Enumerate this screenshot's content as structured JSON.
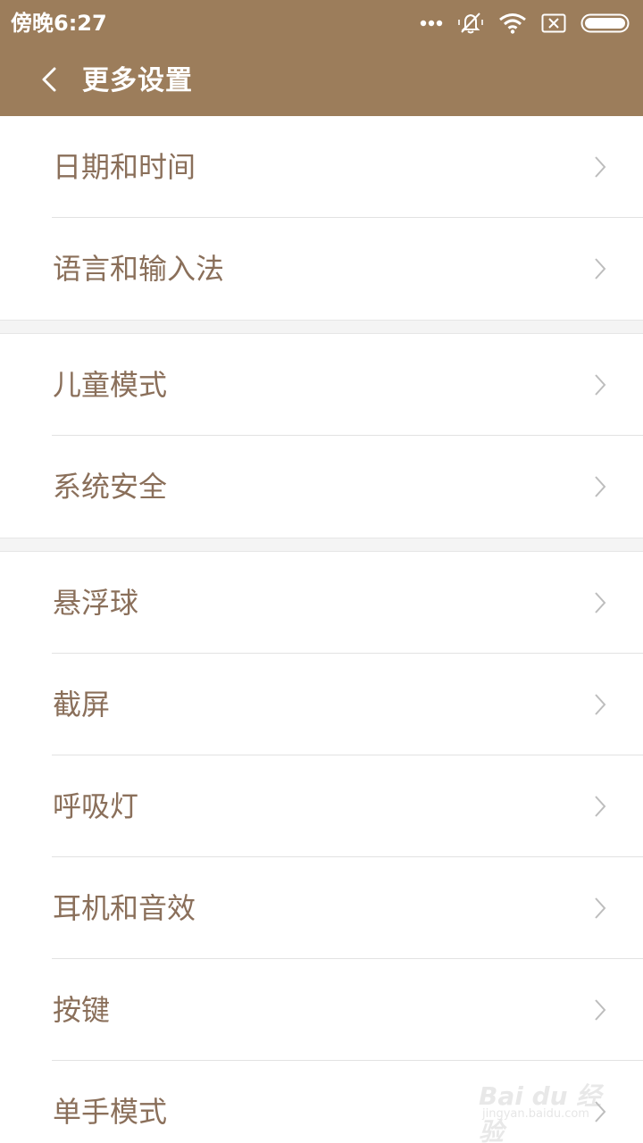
{
  "status_bar": {
    "time": "傍晚6:27",
    "icons": [
      "more-dots-icon",
      "bell-mute-icon",
      "wifi-icon",
      "no-sim-icon",
      "battery-icon"
    ]
  },
  "header": {
    "back_icon": "chevron-left-icon",
    "title": "更多设置"
  },
  "groups": [
    {
      "items": [
        {
          "label": "日期和时间"
        },
        {
          "label": "语言和输入法"
        }
      ]
    },
    {
      "items": [
        {
          "label": "儿童模式"
        },
        {
          "label": "系统安全"
        }
      ]
    },
    {
      "items": [
        {
          "label": "悬浮球"
        },
        {
          "label": "截屏"
        },
        {
          "label": "呼吸灯"
        },
        {
          "label": "耳机和音效"
        },
        {
          "label": "按键"
        },
        {
          "label": "单手模式"
        }
      ]
    }
  ],
  "watermark": {
    "brand": "Bai du 经验",
    "url": "jingyan.baidu.com"
  },
  "colors": {
    "accent": "#9c7d5b",
    "text": "#8a6f5a",
    "chevron": "#bdbdbd"
  }
}
